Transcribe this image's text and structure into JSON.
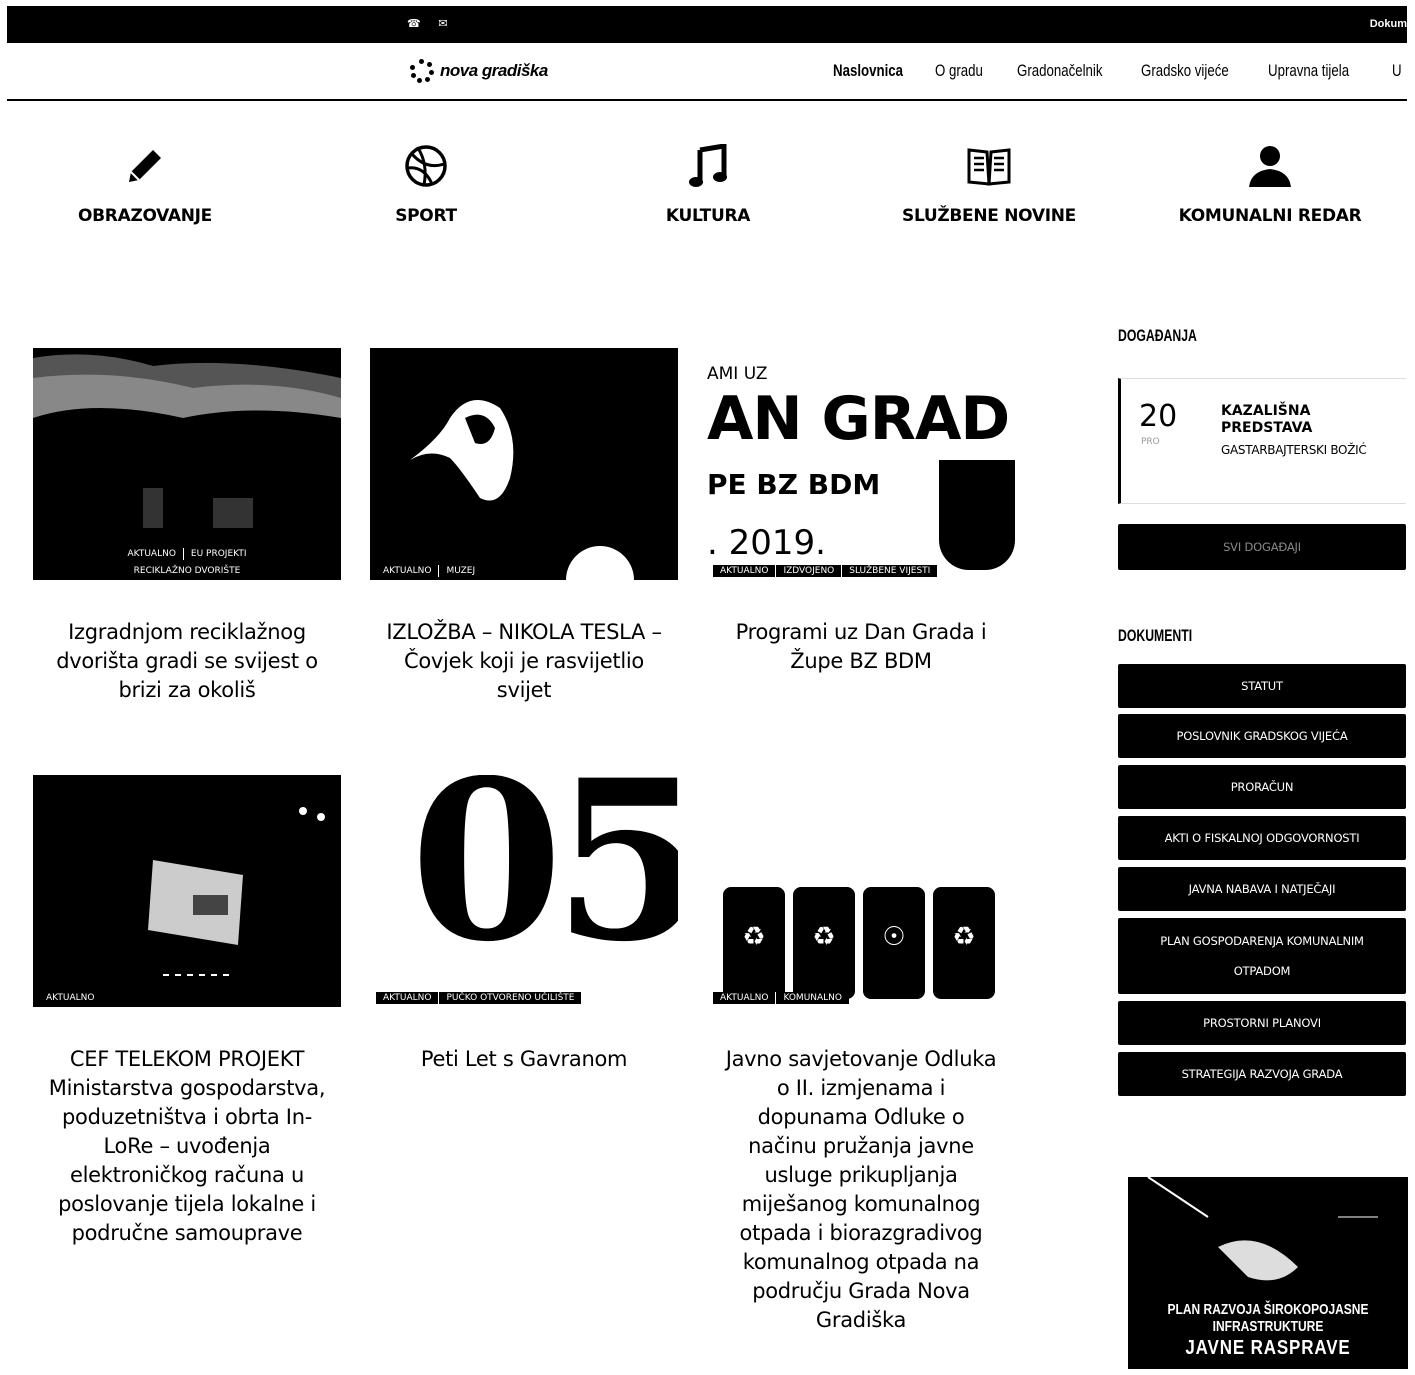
{
  "topbar": {
    "doc_link": "Dokum"
  },
  "header": {
    "logo_text": "nova gradiška",
    "nav": [
      "Naslovnica",
      "O gradu",
      "Gradonačelnik",
      "Gradsko vijeće",
      "Upravna tijela",
      "U"
    ]
  },
  "categories": [
    {
      "label": "OBRAZOVANJE",
      "icon": "pencil-icon"
    },
    {
      "label": "SPORT",
      "icon": "basketball-icon"
    },
    {
      "label": "KULTURA",
      "icon": "music-note-icon"
    },
    {
      "label": "SLUŽBENE NOVINE",
      "icon": "book-icon"
    },
    {
      "label": "KOMUNALNI REDAR",
      "icon": "user-icon"
    }
  ],
  "articles": [
    {
      "title": "Izgradnjom reciklažnog dvorišta gradi se svijest o brizi za okoliš",
      "tags": [
        "AKTUALNO",
        "EU PROJEKTI",
        "RECIKLAŽNO DVORIŠTE"
      ]
    },
    {
      "title": "IZLOŽBA – NIKOLA TESLA – Čovjek koji je rasvijetlio svijet",
      "tags": [
        "AKTUALNO",
        "MUZEJ"
      ]
    },
    {
      "title": "Programi uz Dan Grada i Župe BZ BDM",
      "tags": [
        "AKTUALNO",
        "IZDVOJENO",
        "SLUŽBENE VIJESTI"
      ],
      "image_text": {
        "line1": "AMI UZ",
        "line2": "AN GRAD",
        "line3": "PE BZ BDM",
        "line4": ". 2019."
      }
    },
    {
      "title": "CEF TELEKOM PROJEKT Ministarstva gospodarstva, poduzetništva i obrta In-LoRe – uvođenja elektroničkog računa u poslovanje tijela lokalne i područne samouprave",
      "tags": [
        "AKTUALNO"
      ]
    },
    {
      "title": "Peti Let s Gavranom",
      "tags": [
        "AKTUALNO",
        "PUČKO OTVORENO UČILIŠTE"
      ],
      "image_text": {
        "big": "05."
      }
    },
    {
      "title": "Javno savjetovanje Odluka o II. izmjenama i dopunama Odluke o načinu pružanja javne usluge prikupljanja miješanog komunalnog otpada i biorazgradivog komunalnog otpada na području Grada Nova Gradiška",
      "tags": [
        "AKTUALNO",
        "KOMUNALNO"
      ]
    }
  ],
  "sidebar": {
    "events_heading": "DOGAĐANJA",
    "event": {
      "day": "20",
      "month": "PRO",
      "title": "KAZALIŠNA PREDSTAVA",
      "subtitle": "GASTARBAJTERSKI BOŽIĆ"
    },
    "all_events": "SVI DOGAĐAJI",
    "docs_heading": "DOKUMENTI",
    "docs": [
      "STATUT",
      "POSLOVNIK GRADSKOG VIJEĆA",
      "PRORAČUN",
      "AKTI O FISKALNOJ ODGOVORNOSTI",
      "JAVNA NABAVA I NATJEČAJI",
      "PLAN GOSPODARENJA KOMUNALNIM OTPADOM",
      "PROSTORNI PLANOVI",
      "STRATEGIJA RAZVOJA GRADA"
    ],
    "banner": {
      "line1": "PLAN RAZVOJA ŠIROKOPOJASNE INFRASTRUKTURE",
      "line2": "JAVNE RASPRAVE"
    }
  }
}
